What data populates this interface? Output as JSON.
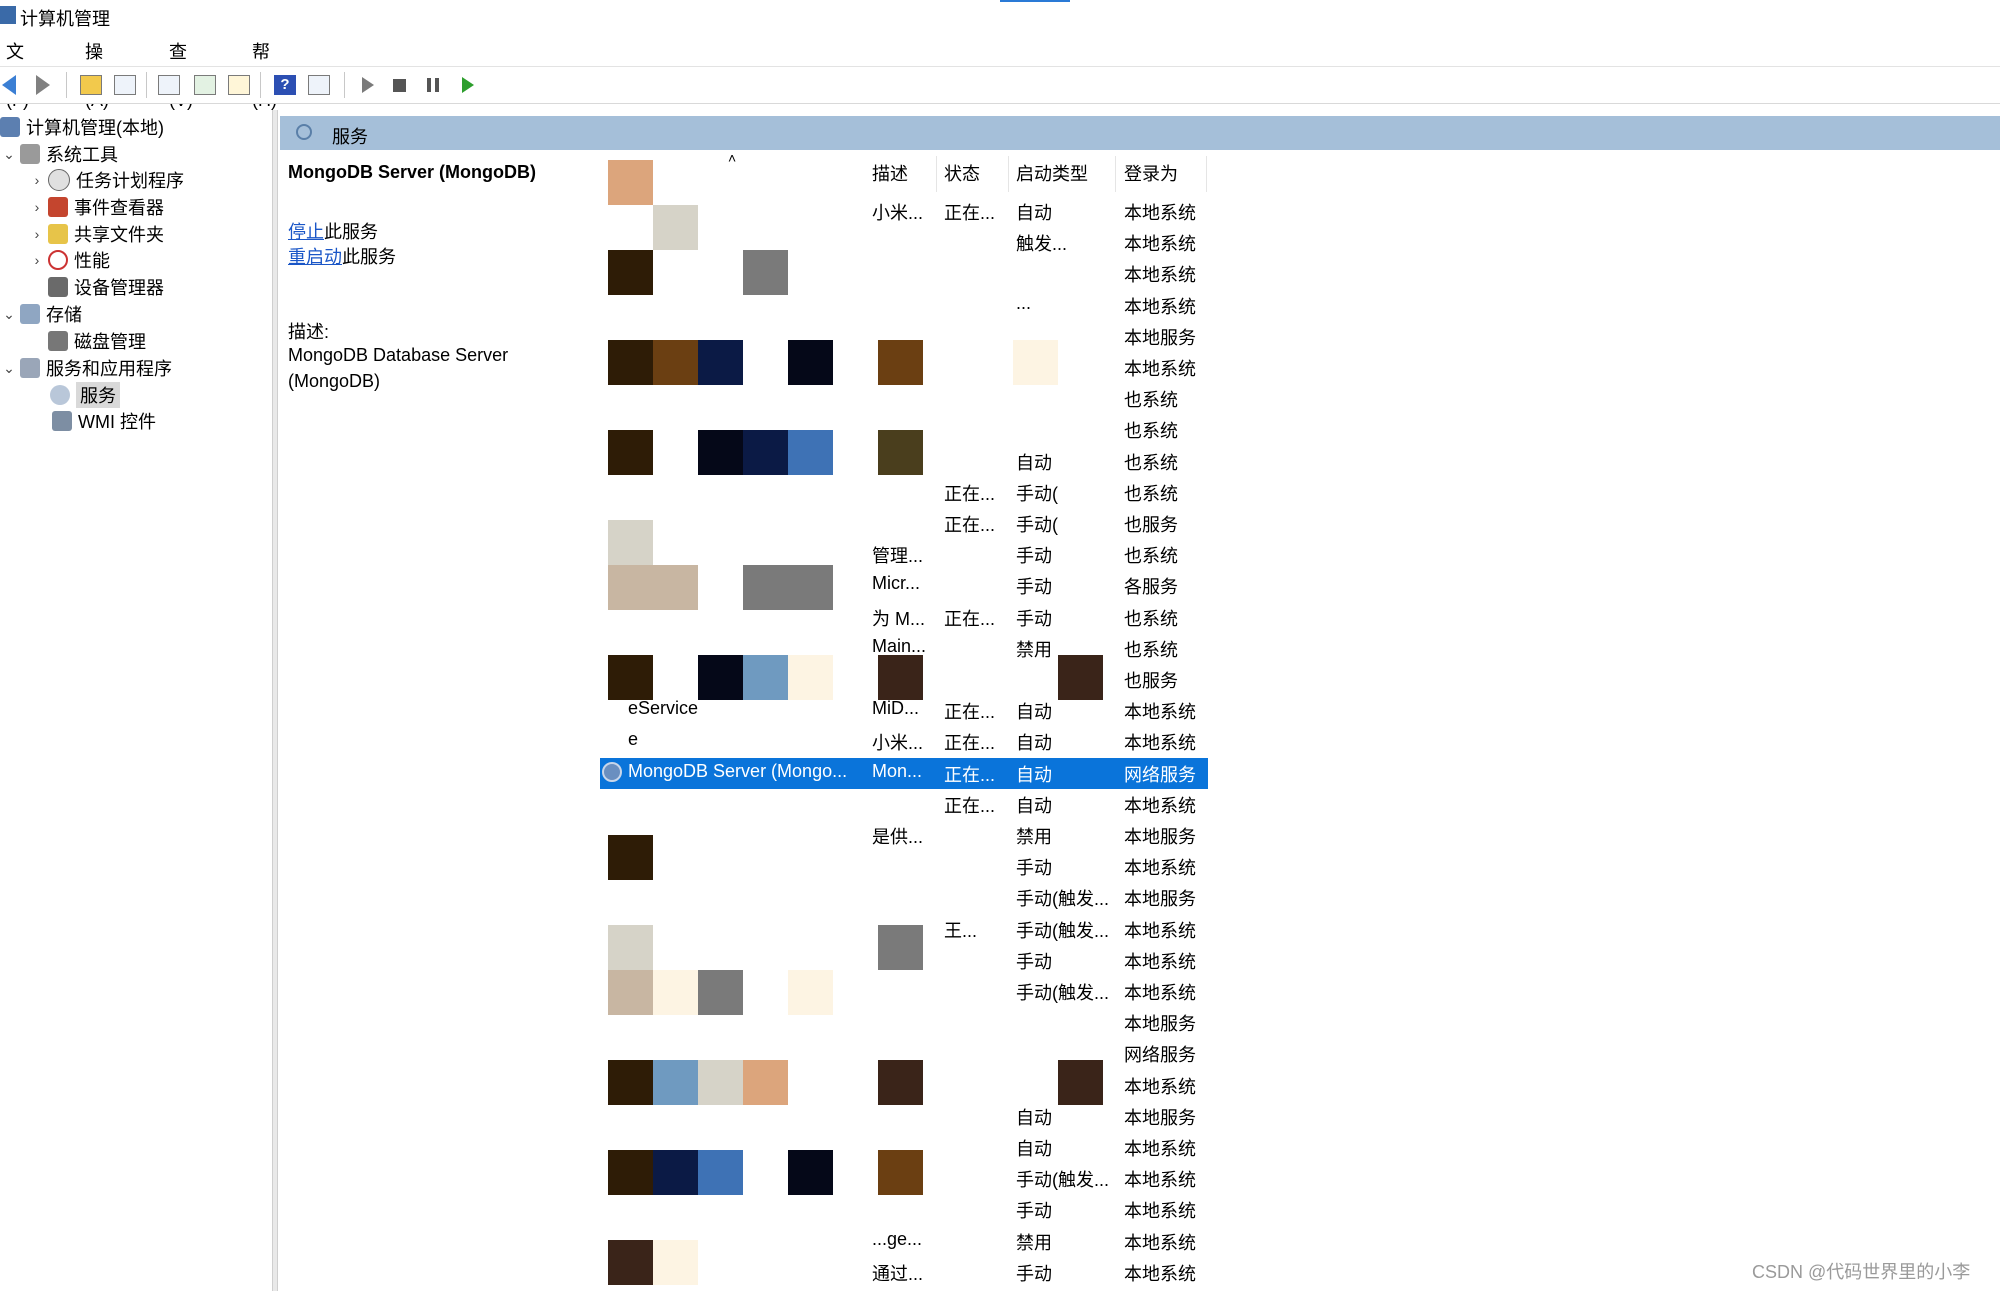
{
  "window": {
    "title": "计算机管理"
  },
  "menu": [
    "文件(F)",
    "操作(A)",
    "查看(V)",
    "帮助(H)"
  ],
  "tree": {
    "root": "计算机管理(本地)",
    "system_tools": "系统工具",
    "task_scheduler": "任务计划程序",
    "event_viewer": "事件查看器",
    "shared_folders": "共享文件夹",
    "performance": "性能",
    "device_manager": "设备管理器",
    "storage": "存储",
    "disk_management": "磁盘管理",
    "services_apps": "服务和应用程序",
    "services": "服务",
    "wmi": "WMI 控件"
  },
  "panel": {
    "header": "服务"
  },
  "detail": {
    "service_name": "MongoDB Server (MongoDB)",
    "stop_link": "停止",
    "stop_suffix": "此服务",
    "restart_link": "重启动",
    "restart_suffix": "此服务",
    "desc_label": "描述:",
    "desc_text": "MongoDB Database Server (MongoDB)"
  },
  "columns": {
    "desc": "描述",
    "status": "状态",
    "startup": "启动类型",
    "logon": "登录为",
    "sort_indicator": "˄"
  },
  "rows": [
    {
      "name": "",
      "desc": "小米...",
      "status": "正在...",
      "startup": "自动",
      "logon": "本地系统"
    },
    {
      "name": "",
      "desc": "",
      "status": "",
      "startup": "触发...",
      "logon": "本地系统"
    },
    {
      "name": "",
      "desc": "",
      "status": "",
      "startup": "",
      "logon": "本地系统"
    },
    {
      "name": "",
      "desc": "",
      "status": "",
      "startup": "...",
      "logon": "本地系统"
    },
    {
      "name": "",
      "desc": "",
      "status": "",
      "startup": "",
      "logon": "本地服务"
    },
    {
      "name": "",
      "desc": "",
      "status": "",
      "startup": "",
      "logon": "本地系统"
    },
    {
      "name": "",
      "desc": "",
      "status": "",
      "startup": "",
      "logon": "也系统"
    },
    {
      "name": "",
      "desc": "",
      "status": "",
      "startup": "",
      "logon": "也系统"
    },
    {
      "name": "",
      "desc": "",
      "status": "",
      "startup": "自动",
      "logon": "也系统"
    },
    {
      "name": "",
      "desc": "",
      "status": "正在...",
      "startup": "手动(",
      "logon": "也系统"
    },
    {
      "name": "",
      "desc": "",
      "status": "正在...",
      "startup": "手动(",
      "logon": "也服务"
    },
    {
      "name": "",
      "desc": "管理...",
      "status": "",
      "startup": "手动",
      "logon": "也系统"
    },
    {
      "name": "",
      "desc": "Micr...",
      "status": "",
      "startup": "手动",
      "logon": "各服务"
    },
    {
      "name": "",
      "desc": "为 M...",
      "status": "正在...",
      "startup": "手动",
      "logon": "也系统"
    },
    {
      "name": "",
      "desc": "Main...",
      "status": "",
      "startup": "禁用",
      "logon": "也系统"
    },
    {
      "name": "",
      "desc": "",
      "status": "",
      "startup": "",
      "logon": "也服务"
    },
    {
      "name": "eService",
      "desc": "MiD...",
      "status": "正在...",
      "startup": "自动",
      "logon": "本地系统"
    },
    {
      "name": "e",
      "desc": "小米...",
      "status": "正在...",
      "startup": "自动",
      "logon": "本地系统"
    },
    {
      "name": "MongoDB Server (Mongo...",
      "desc": "Mon...",
      "status": "正在...",
      "startup": "自动",
      "logon": "网络服务"
    },
    {
      "name": "",
      "desc": "",
      "status": "正在...",
      "startup": "自动",
      "logon": "本地系统"
    },
    {
      "name": "",
      "desc": "是供...",
      "status": "",
      "startup": "禁用",
      "logon": "本地服务"
    },
    {
      "name": "",
      "desc": "",
      "status": "",
      "startup": "手动",
      "logon": "本地系统"
    },
    {
      "name": "",
      "desc": "",
      "status": "",
      "startup": "手动(触发...",
      "logon": "本地服务"
    },
    {
      "name": "",
      "desc": "",
      "status": "王...",
      "startup": "手动(触发...",
      "logon": "本地系统"
    },
    {
      "name": "",
      "desc": "",
      "status": "",
      "startup": "手动",
      "logon": "本地系统"
    },
    {
      "name": "",
      "desc": "",
      "status": "",
      "startup": "手动(触发...",
      "logon": "本地系统"
    },
    {
      "name": "",
      "desc": "",
      "status": "",
      "startup": "",
      "logon": "本地服务"
    },
    {
      "name": "",
      "desc": "",
      "status": "",
      "startup": "",
      "logon": "网络服务"
    },
    {
      "name": "",
      "desc": "",
      "status": "",
      "startup": "",
      "logon": "本地系统"
    },
    {
      "name": "",
      "desc": "",
      "status": "",
      "startup": "自动",
      "logon": "本地服务"
    },
    {
      "name": "",
      "desc": "",
      "status": "",
      "startup": "自动",
      "logon": "本地系统"
    },
    {
      "name": "",
      "desc": "",
      "status": "",
      "startup": "手动(触发...",
      "logon": "本地系统"
    },
    {
      "name": "",
      "desc": "",
      "status": "",
      "startup": "手动",
      "logon": "本地系统"
    },
    {
      "name": "",
      "desc": "...ge...",
      "status": "",
      "startup": "禁用",
      "logon": "本地系统"
    },
    {
      "name": "",
      "desc": "通过...",
      "status": "",
      "startup": "手动",
      "logon": "本地系统"
    }
  ],
  "selected_row": 18,
  "mosaic_colors": {
    "dark_brown": "#2e1c06",
    "brown": "#6b3f12",
    "navy": "#0b1a45",
    "black_navy": "#050818",
    "blue": "#3e72b5",
    "gray": "#7a7a7a",
    "light_gray": "#d6d3c8",
    "beige": "#c8b6a2",
    "peach": "#dca57c",
    "cream": "#fdf4e3",
    "steel": "#6f9ac0",
    "olive": "#4a3e1d",
    "dark_red_brown": "#3a2419"
  },
  "watermark": "CSDN @代码世界里的小李",
  "accent": "#0a74da"
}
